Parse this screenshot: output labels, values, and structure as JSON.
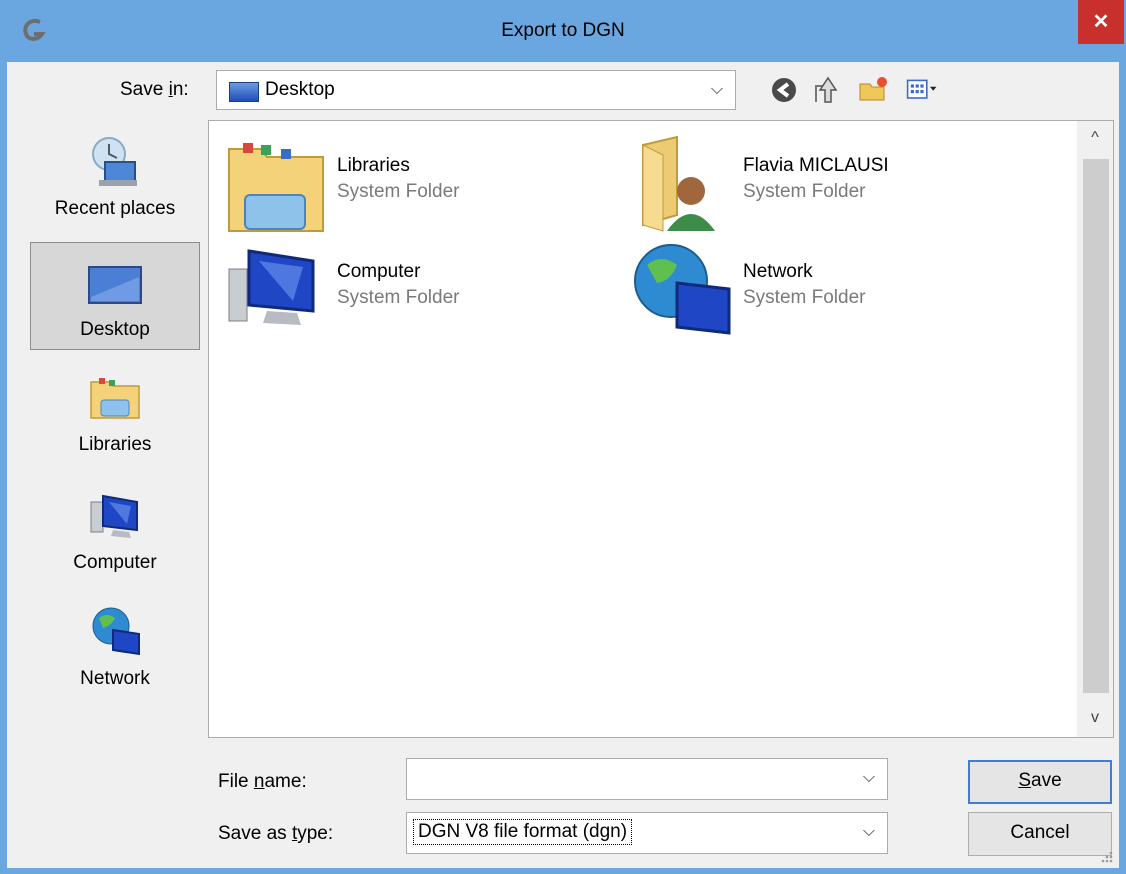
{
  "window": {
    "title": "Export to DGN",
    "close_glyph": "✕"
  },
  "save_in": {
    "label": "Save in:",
    "label_pre": "Save ",
    "label_u": "i",
    "label_post": "n:",
    "value": "Desktop"
  },
  "toolbar": {
    "icons": [
      "back-icon",
      "up-folder-icon",
      "new-folder-icon",
      "view-menu-icon"
    ]
  },
  "places": [
    {
      "label": "Recent places",
      "icon": "recent-places-icon"
    },
    {
      "label": "Desktop",
      "icon": "desktop-icon",
      "selected": true
    },
    {
      "label": "Libraries",
      "icon": "libraries-icon"
    },
    {
      "label": "Computer",
      "icon": "computer-icon"
    },
    {
      "label": "Network",
      "icon": "network-icon"
    }
  ],
  "files": [
    {
      "name": "Libraries",
      "type": "System Folder",
      "icon": "libraries-icon"
    },
    {
      "name": "Flavia MICLAUSI",
      "type": "System Folder",
      "icon": "user-folder-icon"
    },
    {
      "name": "Computer",
      "type": "System Folder",
      "icon": "computer-icon"
    },
    {
      "name": "Network",
      "type": "System Folder",
      "icon": "network-icon"
    }
  ],
  "scroll": {
    "up_glyph": "^",
    "down_glyph": "v"
  },
  "file_name": {
    "label": "File name:",
    "label_pre": "File ",
    "label_u": "n",
    "label_post": "ame:",
    "value": "",
    "placeholder": ""
  },
  "save_as_type": {
    "label": "Save as type:",
    "label_pre": "Save as ",
    "label_u": "t",
    "label_post": "ype:",
    "value": "DGN V8 file format  (dgn)"
  },
  "buttons": {
    "save_u": "S",
    "save_rest": "ave",
    "cancel": "Cancel"
  },
  "colors": {
    "titlebar": "#6aa6e0",
    "close": "#c7302c",
    "selected_place": "#d7d7d7",
    "default_button_border": "#3c7fd1"
  }
}
